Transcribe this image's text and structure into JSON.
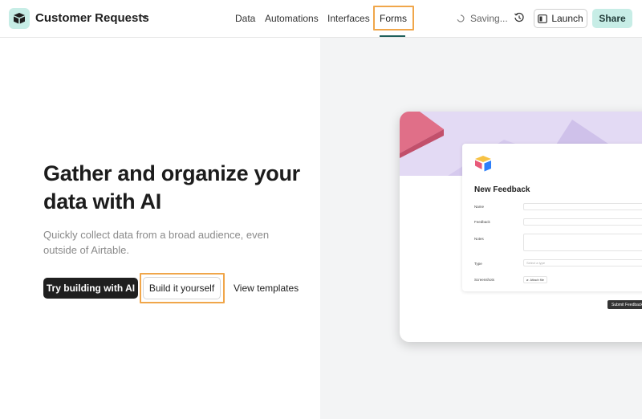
{
  "header": {
    "base_name": "Customer Requests",
    "tabs": [
      {
        "label": "Data"
      },
      {
        "label": "Automations"
      },
      {
        "label": "Interfaces"
      },
      {
        "label": "Forms",
        "active": true
      }
    ],
    "saving_label": "Saving...",
    "launch_label": "Launch",
    "share_label": "Share"
  },
  "hero": {
    "headline": "Gather and organize your data with AI",
    "subtext": "Quickly collect data from a broad audience, even outside of Airtable.",
    "try_ai_label": "Try building with AI",
    "build_label": "Build it yourself",
    "templates_label": "View templates"
  },
  "preview": {
    "form_title": "New Feedback",
    "fields": [
      {
        "label": "Name"
      },
      {
        "label": "Feedback"
      },
      {
        "label": "Notes"
      },
      {
        "label": "Type",
        "placeholder": "Select a type"
      },
      {
        "label": "Screenshots",
        "button": "Attach file"
      }
    ],
    "submit_label": "Submit Feedback"
  },
  "colors": {
    "accent_teal": "#c7ede6",
    "active_underline": "#1f5f5b",
    "highlight_orange": "#f0a64a",
    "banner_lavender": "#e3daf4",
    "banner_pink": "#e06f88"
  },
  "icons": {
    "app_logo": "airtable-logo-icon",
    "chevron": "chevron-down-icon",
    "saving": "spinner-icon",
    "history": "history-icon",
    "launch": "launch-icon"
  }
}
